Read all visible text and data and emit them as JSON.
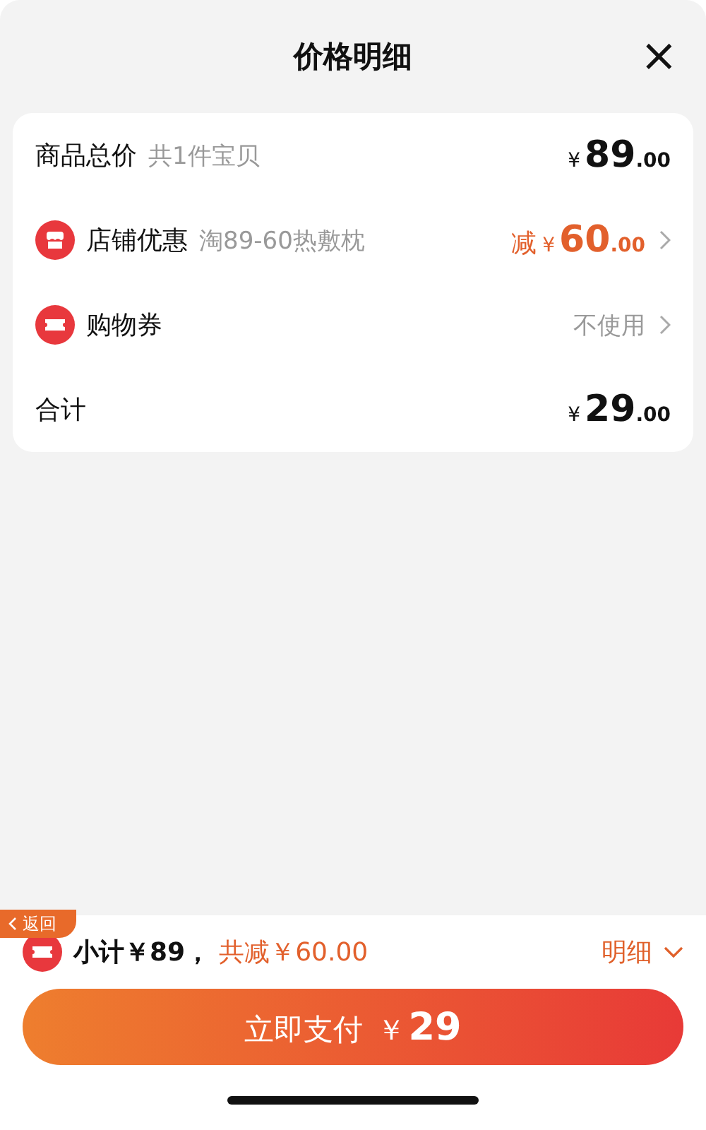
{
  "header": {
    "title": "价格明细",
    "close": "×"
  },
  "rows": [
    {
      "kind": "plain",
      "label": "商品总价",
      "note": "共1件宝贝",
      "price": {
        "currency": "¥",
        "whole": "89",
        "cents": ".00"
      }
    },
    {
      "kind": "shop",
      "label": "店铺优惠",
      "note": "淘89-60热敷枕",
      "price": {
        "prefix": "减",
        "currency": "¥",
        "whole": "60",
        "cents": ".00"
      }
    },
    {
      "kind": "coupon",
      "label": "购物券",
      "value": "不使用"
    },
    {
      "kind": "plain",
      "label": "合计",
      "price": {
        "currency": "¥",
        "whole": "29",
        "cents": ".00"
      }
    }
  ],
  "back_tab": {
    "label": "返回"
  },
  "summary": {
    "subtotal": "小计￥89，",
    "discount": "共减￥60.00",
    "details": "明细"
  },
  "pay_button": {
    "label": "立即支付",
    "currency": "￥",
    "amount": "29"
  }
}
